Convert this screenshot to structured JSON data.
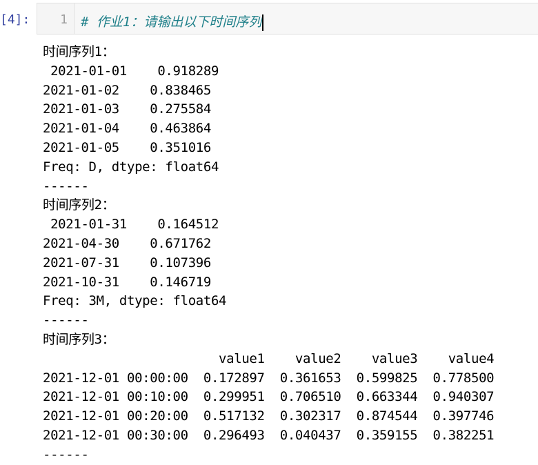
{
  "cell": {
    "prompt": "[4]:",
    "line_number": "1",
    "code": "# 作业1：请输出以下时间序列"
  },
  "output": {
    "lines": [
      "时间序列1：",
      " 2021-01-01    0.918289",
      "2021-01-02    0.838465",
      "2021-01-03    0.275584",
      "2021-01-04    0.463864",
      "2021-01-05    0.351016",
      "Freq: D, dtype: float64",
      "------",
      "时间序列2：",
      " 2021-01-31    0.164512",
      "2021-04-30    0.671762",
      "2021-07-31    0.107396",
      "2021-10-31    0.146719",
      "Freq: 3M, dtype: float64",
      "------",
      "时间序列3：",
      "                       value1    value2    value3    value4",
      "2021-12-01 00:00:00  0.172897  0.361653  0.599825  0.778500",
      "2021-12-01 00:10:00  0.299951  0.706510  0.663344  0.940307",
      "2021-12-01 00:20:00  0.517132  0.302317  0.874544  0.397746",
      "2021-12-01 00:30:00  0.296493  0.040437  0.359155  0.382251",
      "------"
    ]
  }
}
